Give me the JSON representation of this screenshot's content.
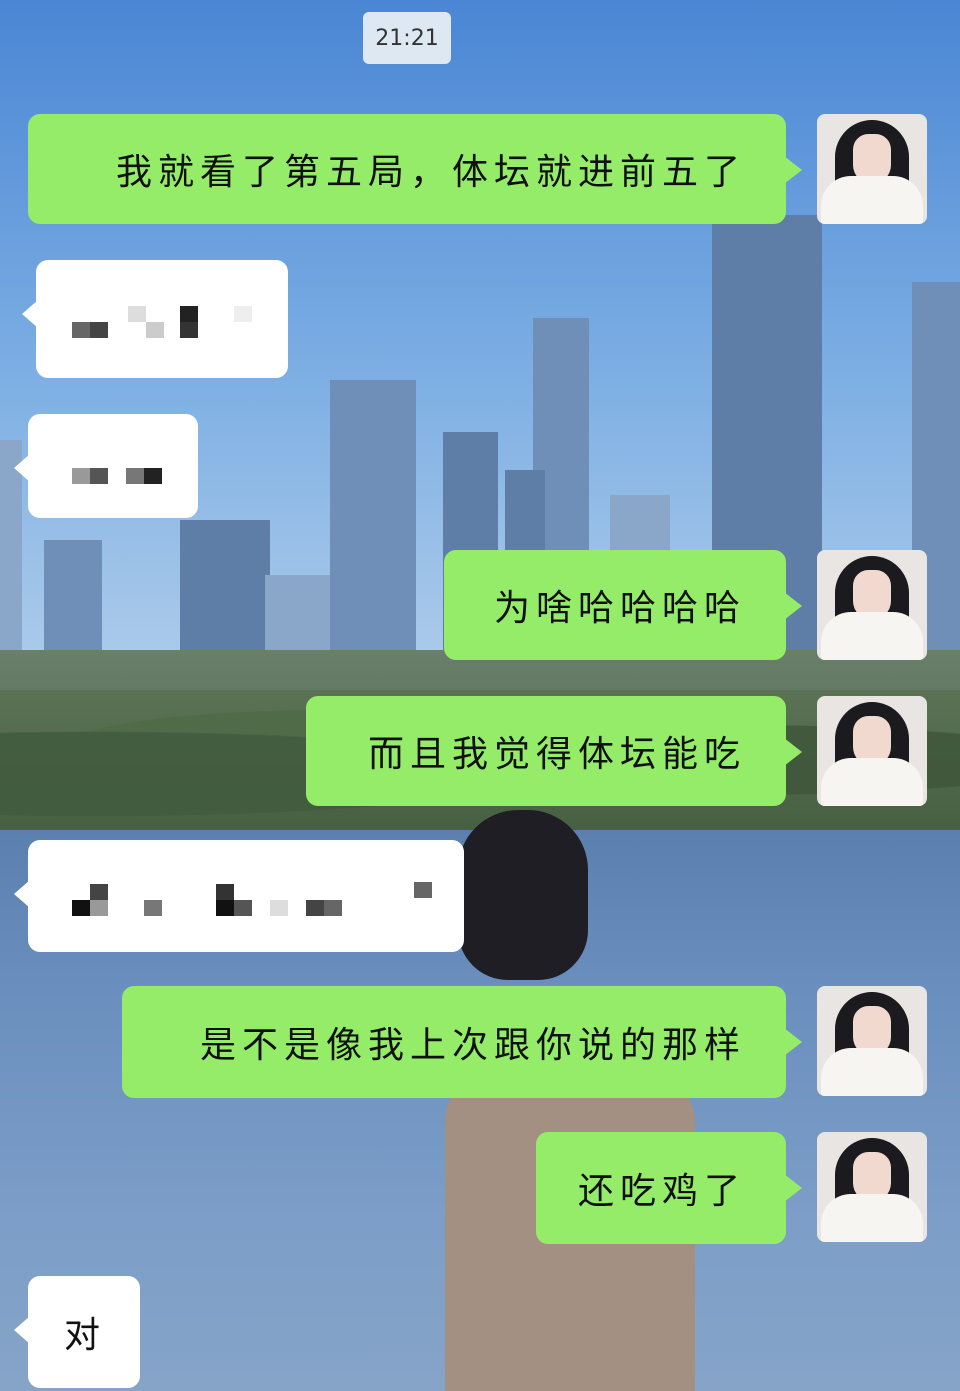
{
  "timestamp": "21:21",
  "colors": {
    "sent_bubble": "#95ec69",
    "received_bubble": "#ffffff",
    "time_badge": "#dde8f3"
  },
  "messages": [
    {
      "side": "sent",
      "text": "我就看了第五局，体坛就进前五了"
    },
    {
      "side": "received",
      "text": "",
      "redacted": true
    },
    {
      "side": "received",
      "text": "",
      "redacted": true
    },
    {
      "side": "sent",
      "text": "为啥哈哈哈哈"
    },
    {
      "side": "sent",
      "text": "而且我觉得体坛能吃"
    },
    {
      "side": "received",
      "text": "",
      "redacted": true
    },
    {
      "side": "sent",
      "text": "是不是像我上次跟你说的那样"
    },
    {
      "side": "sent",
      "text": "还吃鸡了"
    },
    {
      "side": "received",
      "text": "对"
    }
  ],
  "avatar_icon": "user-avatar-photo"
}
